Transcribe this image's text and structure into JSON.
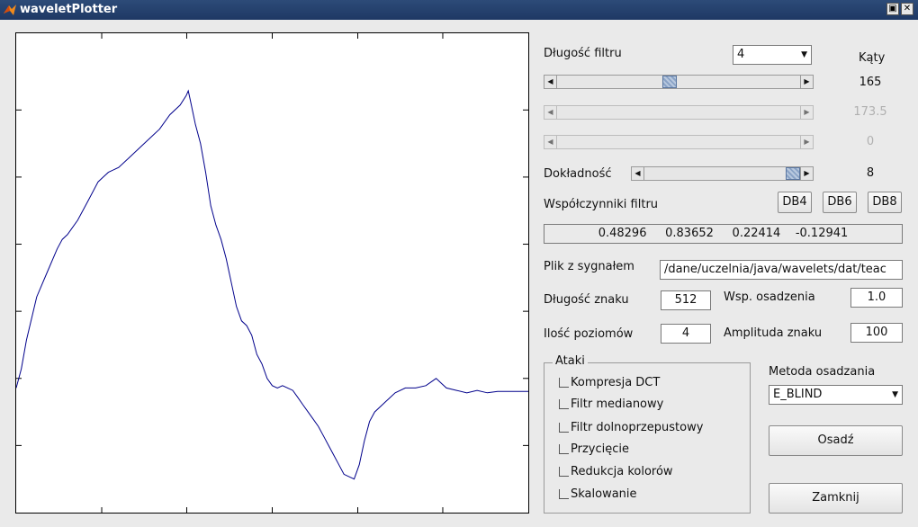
{
  "window": {
    "title": "waveletPlotter",
    "btn_restore": "▣",
    "btn_close": "✕"
  },
  "controls": {
    "filter_length_label": "Długość filtru",
    "filter_length_value": "4",
    "angles_label": "Kąty",
    "angle1": "165",
    "angle2": "173.5",
    "angle3": "0",
    "slider1_level": 0.46,
    "slider2_level": 0.0,
    "slider3_level": 0.0,
    "accuracy_label": "Dokładność",
    "accuracy_value": "8",
    "accuracy_level": 1.0,
    "coeffs_label": "Współczynniki filtru",
    "db4": "DB4",
    "db6": "DB6",
    "db8": "DB8",
    "coeffs_value": "0.48296     0.83652     0.22414    -0.12941",
    "signal_file_label": "Plik z sygnałem",
    "signal_file_value": "/dane/uczelnia/java/wavelets/dat/teac",
    "mark_length_label": "Długość znaku",
    "mark_length_value": "512",
    "embed_coef_label": "Wsp. osadzenia",
    "embed_coef_value": "1.0",
    "levels_label": "Ilość poziomów",
    "levels_value": "4",
    "amplitude_label": "Amplituda znaku",
    "amplitude_value": "100",
    "attacks_label": "Ataki",
    "attacks": [
      "Kompresja DCT",
      "Filtr medianowy",
      "Filtr dolnoprzepustowy",
      "Przycięcie",
      "Redukcja kolorów",
      "Skalowanie"
    ],
    "method_label": "Metoda osadzania",
    "method_value": "E_BLIND",
    "embed_button": "Osadź",
    "close_button": "Zamknij"
  },
  "colors": {
    "titlebar": "#1e3864",
    "line": "#00008b",
    "thumb": "#8aa3c6"
  },
  "chart_data": {
    "type": "line",
    "title": "",
    "xlabel": "",
    "ylabel": "",
    "x_range": [
      0,
      100
    ],
    "y_range": [
      0,
      100
    ],
    "series": [
      {
        "values": [
          [
            0,
            26
          ],
          [
            1,
            30
          ],
          [
            2,
            36
          ],
          [
            4,
            45
          ],
          [
            6,
            50
          ],
          [
            8,
            55
          ],
          [
            9,
            57
          ],
          [
            10,
            58
          ],
          [
            12,
            61
          ],
          [
            14,
            65
          ],
          [
            16,
            69
          ],
          [
            17,
            70
          ],
          [
            18,
            71
          ],
          [
            20,
            72
          ],
          [
            22,
            74
          ],
          [
            24,
            76
          ],
          [
            26,
            78
          ],
          [
            28,
            80
          ],
          [
            30,
            83
          ],
          [
            32,
            85
          ],
          [
            33.2,
            87
          ],
          [
            33.6,
            88
          ],
          [
            34,
            86
          ],
          [
            35,
            81
          ],
          [
            36,
            77
          ],
          [
            37,
            71
          ],
          [
            38,
            64
          ],
          [
            39,
            60
          ],
          [
            40,
            57
          ],
          [
            41,
            53
          ],
          [
            42,
            48
          ],
          [
            43,
            43
          ],
          [
            44,
            40
          ],
          [
            45,
            39
          ],
          [
            46,
            37
          ],
          [
            47,
            33
          ],
          [
            48,
            31
          ],
          [
            49,
            28
          ],
          [
            50,
            26.5
          ],
          [
            51,
            26
          ],
          [
            52,
            26.5
          ],
          [
            53,
            26
          ],
          [
            54,
            25.5
          ],
          [
            55,
            24
          ],
          [
            56,
            22.5
          ],
          [
            57,
            21
          ],
          [
            58,
            19.5
          ],
          [
            59,
            18
          ],
          [
            60,
            16
          ],
          [
            61,
            14
          ],
          [
            62,
            12
          ],
          [
            63,
            10
          ],
          [
            64,
            8
          ],
          [
            66,
            7
          ],
          [
            67,
            10
          ],
          [
            68,
            15
          ],
          [
            69,
            19
          ],
          [
            70,
            21
          ],
          [
            72,
            23
          ],
          [
            74,
            25
          ],
          [
            76,
            26
          ],
          [
            78,
            26
          ],
          [
            80,
            26.5
          ],
          [
            82,
            28
          ],
          [
            83,
            27
          ],
          [
            84,
            26
          ],
          [
            86,
            25.5
          ],
          [
            88,
            25
          ],
          [
            90,
            25.5
          ],
          [
            92,
            25
          ],
          [
            94,
            25.3
          ],
          [
            96,
            25.3
          ],
          [
            98,
            25.3
          ],
          [
            100,
            25.3
          ]
        ]
      }
    ]
  }
}
